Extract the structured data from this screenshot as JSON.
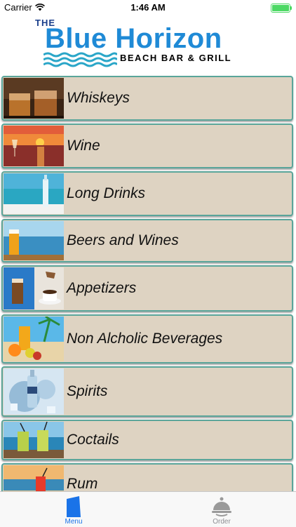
{
  "status_bar": {
    "carrier": "Carrier",
    "time": "1:46 AM"
  },
  "header": {
    "the": "THE",
    "title": "Blue Horizon",
    "subtitle": "BEACH BAR & GRILL"
  },
  "menu": {
    "items": [
      {
        "label": "Whiskeys",
        "icon": "whiskey-glasses-photo"
      },
      {
        "label": "Wine",
        "icon": "sunset-wine-photo"
      },
      {
        "label": "Long Drinks",
        "icon": "bottle-beach-photo"
      },
      {
        "label": "Beers and Wines",
        "icon": "beer-sea-photo"
      },
      {
        "label": "Appetizers",
        "icon": "coffee-photo"
      },
      {
        "label": "Non Alcholic Beverages",
        "icon": "fruit-juice-photo"
      },
      {
        "label": "Spirits",
        "icon": "vodka-splash-photo"
      },
      {
        "label": "Coctails",
        "icon": "cocktails-sea-photo"
      },
      {
        "label": "Rum",
        "icon": "rum-beach-photo"
      }
    ]
  },
  "tab_bar": {
    "tabs": [
      {
        "label": "Menu",
        "icon": "menu-icon",
        "active": true
      },
      {
        "label": "Order",
        "icon": "cloche-icon",
        "active": false
      }
    ]
  },
  "colors": {
    "accent": "#1a73e8",
    "item_bg": "#ded3c2",
    "item_border": "#5aa59a",
    "logo_blue": "#1f8ad6"
  }
}
